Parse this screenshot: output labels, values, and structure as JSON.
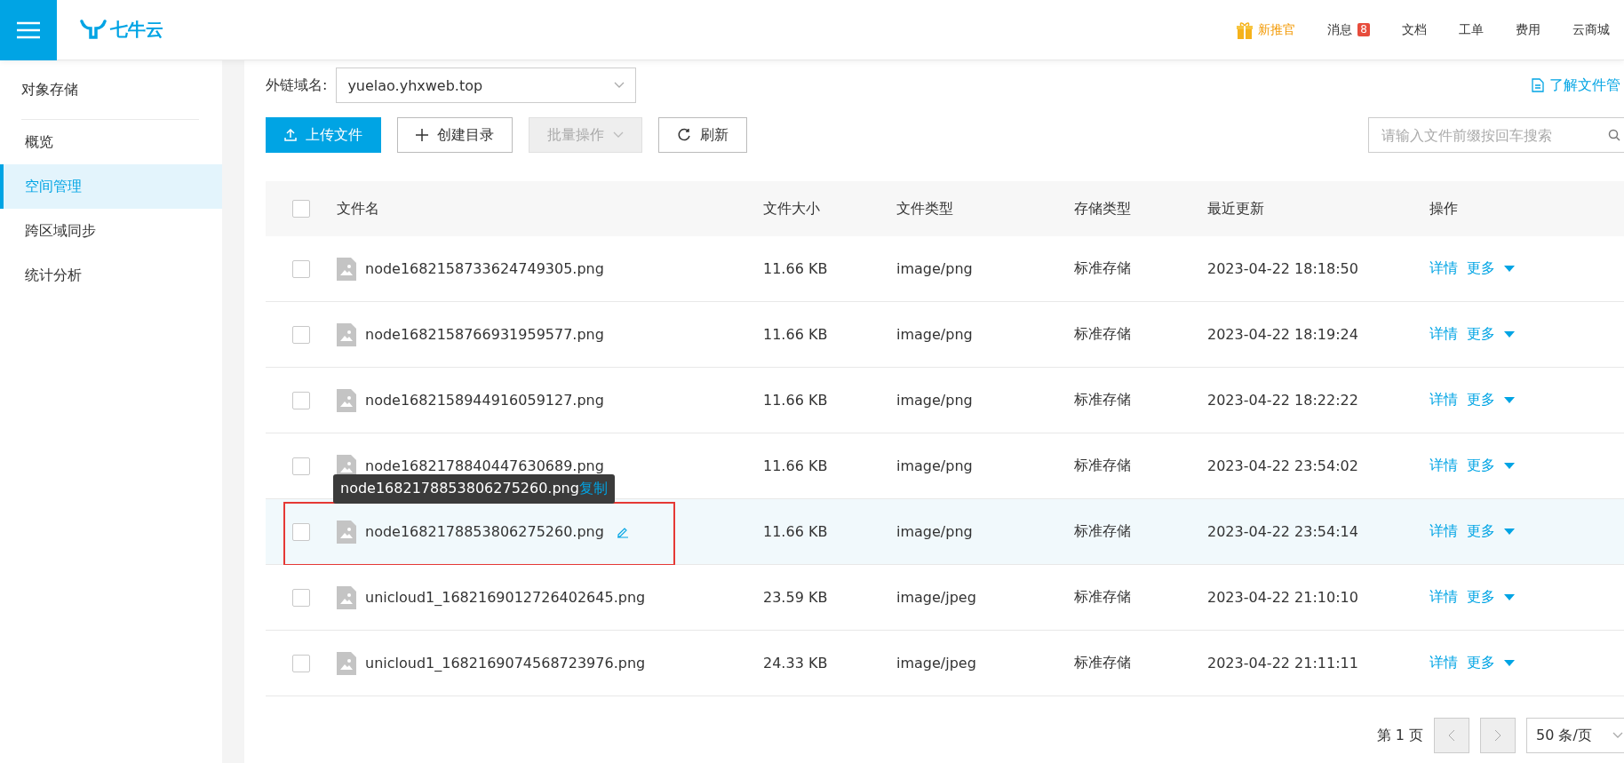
{
  "header": {
    "logo": "七牛云",
    "nav": [
      {
        "label": "新推官",
        "kind": "promo"
      },
      {
        "label": "消息",
        "kind": "badge",
        "badge": "8"
      },
      {
        "label": "文档",
        "kind": "plain"
      },
      {
        "label": "工单",
        "kind": "plain"
      },
      {
        "label": "费用",
        "kind": "plain"
      },
      {
        "label": "云商城",
        "kind": "plain"
      }
    ]
  },
  "sidebar": {
    "title": "对象存储",
    "items": [
      {
        "label": "概览",
        "selected": false
      },
      {
        "label": "空间管理",
        "selected": true
      },
      {
        "label": "跨区域同步",
        "selected": false
      },
      {
        "label": "统计分析",
        "selected": false
      }
    ]
  },
  "domain": {
    "label": "外链域名:",
    "value": "yuelao.yhxweb.top"
  },
  "help_link": "了解文件管",
  "toolbar": {
    "upload": "上传文件",
    "mkdir": "创建目录",
    "batch": {
      "label": "批量操作",
      "disabled": true
    },
    "refresh": "刷新",
    "search": {
      "placeholder": "请输入文件前缀按回车搜索"
    }
  },
  "table": {
    "all_checked": false,
    "columns": [
      "文件名",
      "文件大小",
      "文件类型",
      "存储类型",
      "最近更新",
      "操作"
    ],
    "rows": [
      {
        "name": "node1682158733624749305.png",
        "size": "11.66 KB",
        "type": "image/png",
        "storage": "标准存储",
        "updated": "2023-04-22 18:18:50",
        "actions": [
          "详情",
          "更多"
        ],
        "checked": false,
        "hovered": false,
        "outlined": false
      },
      {
        "name": "node1682158766931959577.png",
        "size": "11.66 KB",
        "type": "image/png",
        "storage": "标准存储",
        "updated": "2023-04-22 18:19:24",
        "actions": [
          "详情",
          "更多"
        ],
        "checked": false,
        "hovered": false,
        "outlined": false
      },
      {
        "name": "node1682158944916059127.png",
        "size": "11.66 KB",
        "type": "image/png",
        "storage": "标准存储",
        "updated": "2023-04-22 18:22:22",
        "actions": [
          "详情",
          "更多"
        ],
        "checked": false,
        "hovered": false,
        "outlined": false
      },
      {
        "name": "node1682178840447630689.png",
        "size": "11.66 KB",
        "type": "image/png",
        "storage": "标准存储",
        "updated": "2023-04-22 23:54:02",
        "actions": [
          "详情",
          "更多"
        ],
        "checked": false,
        "hovered": false,
        "outlined": false
      },
      {
        "name": "node1682178853806275260.png",
        "size": "11.66 KB",
        "type": "image/png",
        "storage": "标准存储",
        "updated": "2023-04-22 23:54:14",
        "actions": [
          "详情",
          "更多"
        ],
        "checked": false,
        "hovered": true,
        "outlined": true,
        "tooltip": {
          "text": "node1682178853806275260.png",
          "action": "复制"
        }
      },
      {
        "name": "unicloud1_1682169012726402645.png",
        "size": "23.59 KB",
        "type": "image/jpeg",
        "storage": "标准存储",
        "updated": "2023-04-22 21:10:10",
        "actions": [
          "详情",
          "更多"
        ],
        "checked": false,
        "hovered": false,
        "outlined": false
      },
      {
        "name": "unicloud1_1682169074568723976.png",
        "size": "24.33 KB",
        "type": "image/jpeg",
        "storage": "标准存储",
        "updated": "2023-04-22 21:11:11",
        "actions": [
          "详情",
          "更多"
        ],
        "checked": false,
        "hovered": false,
        "outlined": false
      }
    ]
  },
  "pagination": {
    "page": "第 1 页",
    "page_size": "50 条/页",
    "prev_disabled": true,
    "next_disabled": true
  }
}
